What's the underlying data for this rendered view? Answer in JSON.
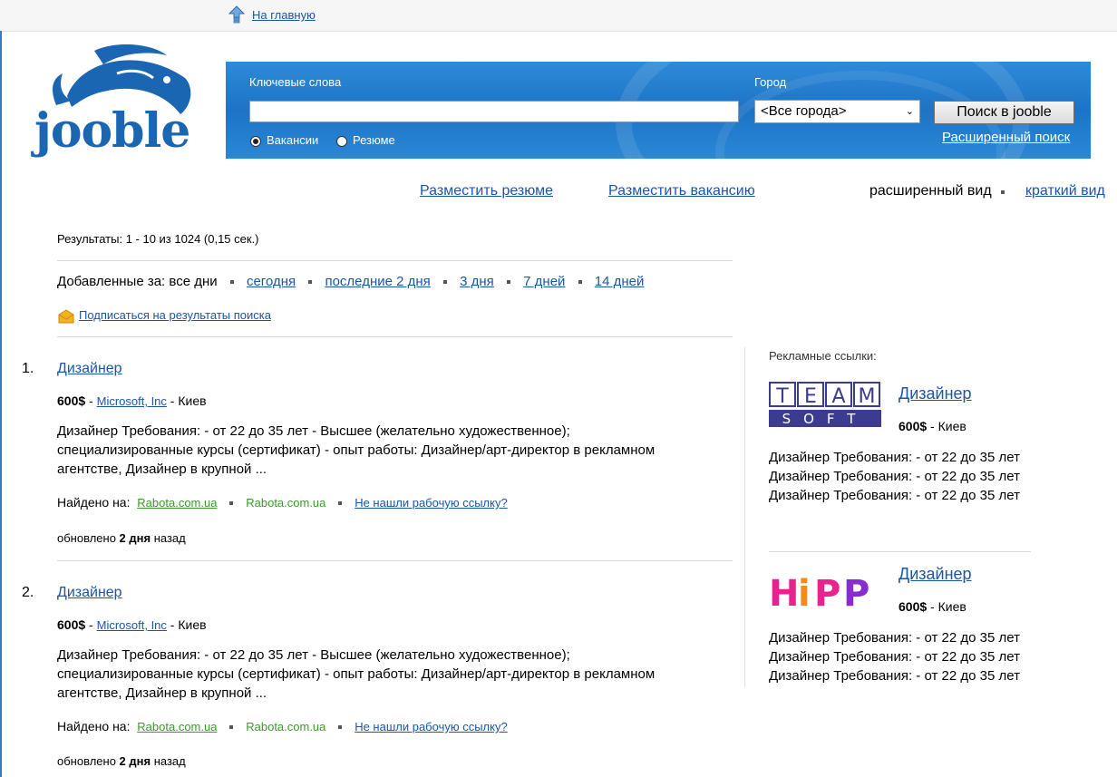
{
  "top": {
    "home_link": "На главную"
  },
  "logo": {
    "text": "jooble"
  },
  "search": {
    "keywords_label": "Ключевые слова",
    "keywords_value": "",
    "city_label": "Город",
    "city_value": "<Все города>",
    "button": "Поиск в jooble",
    "advanced": "Расширенный поиск",
    "radio_vacancies": "Вакансии",
    "radio_resumes": "Резюме"
  },
  "links": {
    "post_resume": "Разместить резюме",
    "post_vacancy": "Разместить вакансию",
    "extended_view": "расширенный вид",
    "short_view": "краткий вид"
  },
  "results": {
    "count": "Результаты: 1 - 10 из 1024 (0,15 сек.)",
    "added_label": "Добавленные за: все дни",
    "added_options": [
      "сегодня",
      "последние 2 дня",
      "3 дня",
      "7 дней",
      "14 дней"
    ],
    "subscribe": "Подписаться на результаты поиска",
    "items": [
      {
        "num": "1.",
        "title": "Дизайнер",
        "salary": "600$",
        "sep1": " - ",
        "company": "Microsoft, Inc",
        "sep2": " - ",
        "city": "Киев",
        "desc": "Дизайнер Требования: - от 22 до 35 лет - Высшее (желательно художественное); специализированные курсы (сертификат) - опыт работы: Дизайнер/арт-директор в рекламном агентстве, Дизайнер в крупной ...",
        "found_label": "Найдено на:",
        "src1": "Rabota.com.ua",
        "src2": "Rabota.com.ua",
        "not_found": "Не нашли рабочую ссылку?",
        "updated_prefix": "обновлено",
        "updated_bold": "2 дня",
        "updated_suffix": "назад"
      },
      {
        "num": "2.",
        "title": "Дизайнер",
        "salary": "600$",
        "sep1": " - ",
        "company": "Microsoft, Inc",
        "sep2": " - ",
        "city": "Киев",
        "desc": "Дизайнер Требования: - от 22 до 35 лет - Высшее (желательно художественное); специализированные курсы (сертификат) - опыт работы: Дизайнер/арт-директор в рекламном агентстве, Дизайнер в крупной ...",
        "found_label": "Найдено на:",
        "src1": "Rabota.com.ua",
        "src2": "Rabota.com.ua",
        "not_found": "Не нашли рабочую ссылку?",
        "updated_prefix": "обновлено",
        "updated_bold": "2 дня",
        "updated_suffix": "назад"
      }
    ]
  },
  "ads": {
    "header": "Рекламные ссылки:",
    "items": [
      {
        "logo_top": "TEAM",
        "logo_bottom": "SOFT",
        "title": "Дизайнер",
        "salary": "600$",
        "city": " - Киев",
        "lines": [
          "Дизайнер Требования: - от 22 до 35 лет",
          "Дизайнер Требования: - от 22 до 35 лет",
          "Дизайнер Требования: - от 22 до 35 лет"
        ]
      },
      {
        "logo_text": "HiPP",
        "title": "Дизайнер",
        "salary": "600$",
        "city": " - Киев",
        "lines": [
          "Дизайнер Требования: - от 22 до 35 лет",
          "Дизайнер Требования: - от 22 до 35 лет",
          "Дизайнер Требования: - от 22 до 35 лет"
        ]
      }
    ]
  },
  "colors": {
    "link": "#1a55a8",
    "search_bg": "#1d73c6",
    "source_green": "#3a9a2a"
  }
}
